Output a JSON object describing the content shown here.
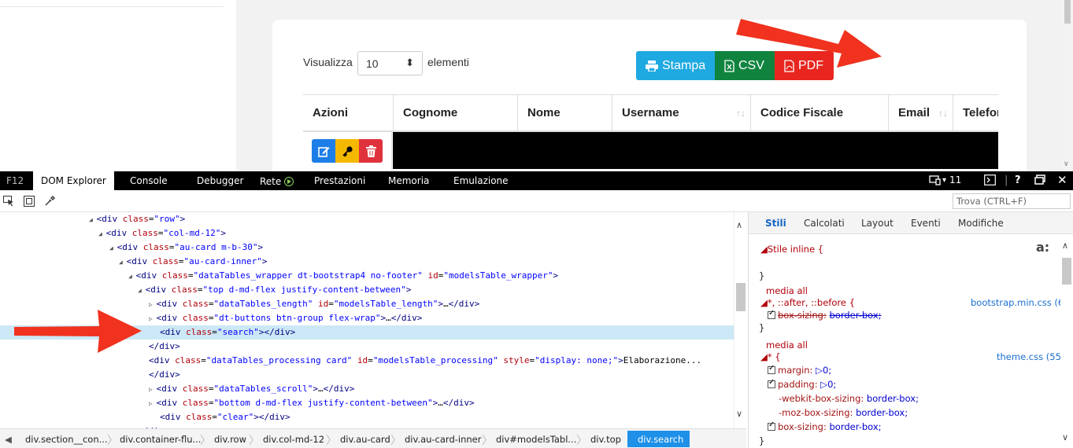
{
  "webpage": {
    "length_label_before": "Visualizza",
    "length_value": "10",
    "length_label_after": "elementi",
    "buttons": {
      "print": "Stampa",
      "csv": "CSV",
      "pdf": "PDF"
    },
    "colors": {
      "print": "#1fa9e1",
      "csv": "#10843f",
      "pdf": "#e8261f",
      "edit": "#1e7ee8",
      "key": "#f5b800",
      "delete": "#e0323c"
    },
    "table_headers": [
      "Azioni",
      "Cognome",
      "Nome",
      "Username",
      "Codice Fiscale",
      "Email",
      "Telefor"
    ]
  },
  "devtools": {
    "tabs": {
      "f12": "F12",
      "dom_explorer": "DOM Explorer",
      "console": "Console",
      "debugger": "Debugger",
      "rete": "Rete",
      "prestazioni": "Prestazioni",
      "memoria": "Memoria",
      "emulazione": "Emulazione"
    },
    "right_controls": {
      "screens_count": "11",
      "help": "?"
    },
    "find_placeholder": "Trova (CTRL+F)",
    "dom_lines": [
      "<div class=\"row\">",
      "<div class=\"col-md-12\">",
      "<div class=\"au-card m-b-30\">",
      "<div class=\"au-card-inner\">",
      "<div class=\"dataTables_wrapper dt-bootstrap4 no-footer\" id=\"modelsTable_wrapper\">",
      "<div class=\"top d-md-flex justify-content-between\">",
      "<div class=\"dataTables_length\" id=\"modelsTable_length\">…</div>",
      "<div class=\"dt-buttons btn-group flex-wrap\">…</div>",
      "<div class=\"search\"></div>",
      "</div>",
      "<div class=\"dataTables_processing card\" id=\"modelsTable_processing\" style=\"display: none;\">Elaborazione...",
      "</div>",
      "<div class=\"dataTables_scroll\">…</div>",
      "<div class=\"bottom d-md-flex justify-content-between\">…</div>",
      "<div class=\"clear\"></div>",
      "</div>"
    ],
    "breadcrumbs": [
      "div.section__con...",
      "div.container-flu...",
      "div.row",
      "div.col-md-12",
      "div.au-card",
      "div.au-card-inner",
      "div#modelsTabl...",
      "div.top",
      "div.search"
    ],
    "styles": {
      "tabs": [
        "Stili",
        "Calcolati",
        "Layout",
        "Eventi",
        "Modifiche"
      ],
      "inline_style": "Stile inline  {",
      "close_brace": "}",
      "aa": "a:",
      "media_all": "media all",
      "rule1_selector": "*, ::after, ::before  {",
      "rule1_source": "bootstrap.min.css (6)",
      "rule1_prop": "box-sizing:",
      "rule1_val": "border-box;",
      "rule2_selector": "*  {",
      "rule2_source": "theme.css (55)",
      "rule2_props": [
        {
          "prop": "margin:",
          "val": "▷0;"
        },
        {
          "prop": "padding:",
          "val": "▷0;"
        },
        {
          "prop": "-webkit-box-sizing:",
          "val": "border-box;"
        },
        {
          "prop": "-moz-box-sizing:",
          "val": "border-box;"
        },
        {
          "prop": "box-sizing:",
          "val": "border-box;"
        }
      ]
    }
  }
}
